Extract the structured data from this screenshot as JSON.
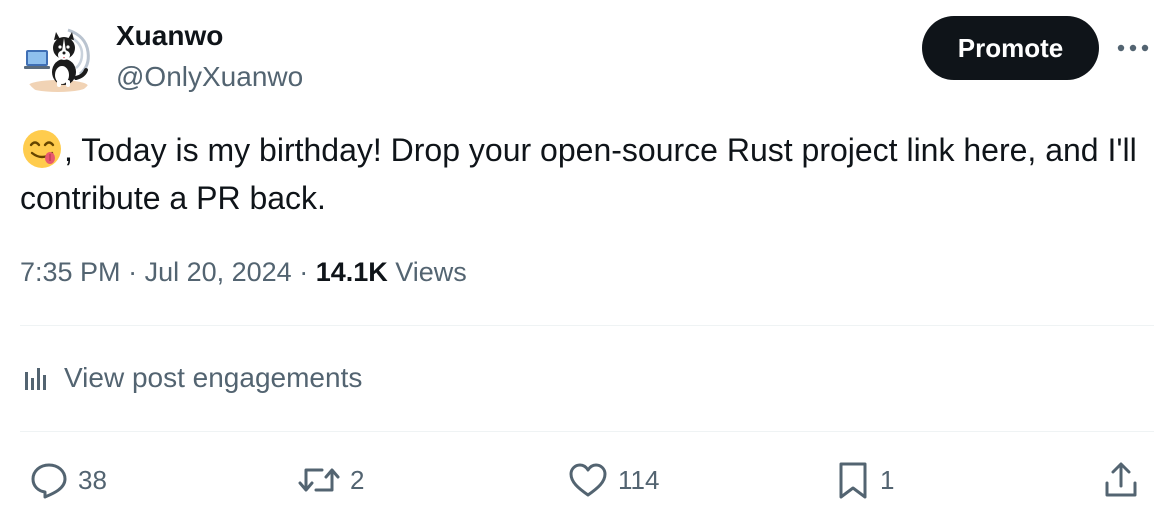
{
  "author": {
    "display_name": "Xuanwo",
    "handle": "@OnlyXuanwo",
    "avatar_icon": "border-collie-at-laptop-avatar"
  },
  "header": {
    "promote_label": "Promote",
    "more_icon": "more-horizontal-icon"
  },
  "tweet": {
    "emoji": "😋",
    "text": ", Today is my birthday! Drop your open-source Rust project link here, and I'll contribute a PR back."
  },
  "meta": {
    "time": "7:35 PM",
    "separator": " · ",
    "date": "Jul 20, 2024",
    "views_count": "14.1K",
    "views_label": " Views"
  },
  "engagements": {
    "label": "View post engagements",
    "icon": "bar-chart-icon"
  },
  "actions": {
    "replies": "38",
    "reposts": "2",
    "likes": "114",
    "bookmarks": "1"
  },
  "colors": {
    "text_primary": "#0f1419",
    "text_secondary": "#536471",
    "divider": "#eff3f4",
    "button_bg": "#0f1419"
  }
}
